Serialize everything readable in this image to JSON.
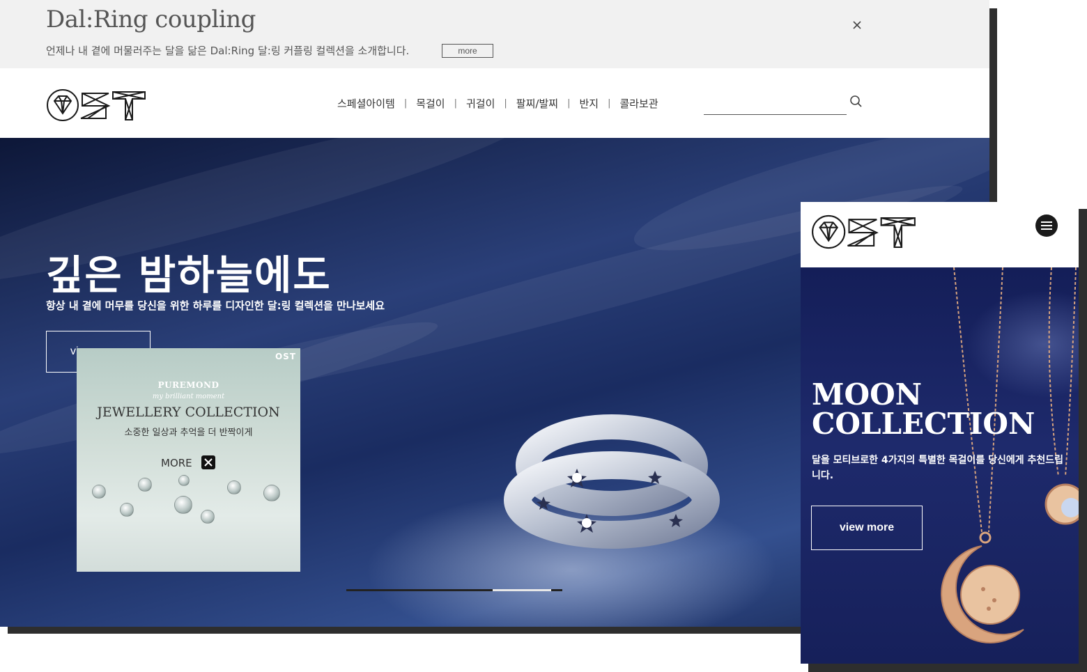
{
  "promo": {
    "title": "Dal:Ring coupling",
    "text": "언제나 내 곁에 머물러주는 달을 닮은 Dal:Ring 달:링 커플링 컬렉션을 소개합니다.",
    "more_label": "more"
  },
  "nav": {
    "logo_text": "OST",
    "items": [
      "스페셜아이템",
      "목걸이",
      "귀걸이",
      "팔찌/발찌",
      "반지",
      "콜라보관"
    ],
    "separator": "|",
    "search_placeholder": ""
  },
  "hero": {
    "title": "깊은 밤하늘에도",
    "subtitle": "항상 내 곁에 머무를 당신을 위한 하루를 디자인한 달:링 컬렉션을 만나보세요",
    "button_label": "vi",
    "slides_total": 3,
    "slide_active": 3
  },
  "popup": {
    "logo": "OST",
    "brand": "PUREMOND",
    "tagline": "my brilliant moment",
    "title": "JEWELLERY COLLECTION",
    "subtitle": "소중한 일상과 추억을 더 반짝이게",
    "more_label": "MORE"
  },
  "mobile": {
    "logo_text": "OST",
    "title_line1": "MOON",
    "title_line2": "COLLECTION",
    "subtitle": "달을 모티브로한 4가지의 특별한 목걸이를 당신에게 추천드립니다.",
    "button_label": "view more"
  },
  "colors": {
    "promo_bg": "#f1f1f1",
    "hero_navy": "#1f3266",
    "mobile_navy": "#1a2462",
    "frame_shadow": "#2e2e2e",
    "text_dark": "#333333",
    "rose_gold": "#d9a47e"
  }
}
